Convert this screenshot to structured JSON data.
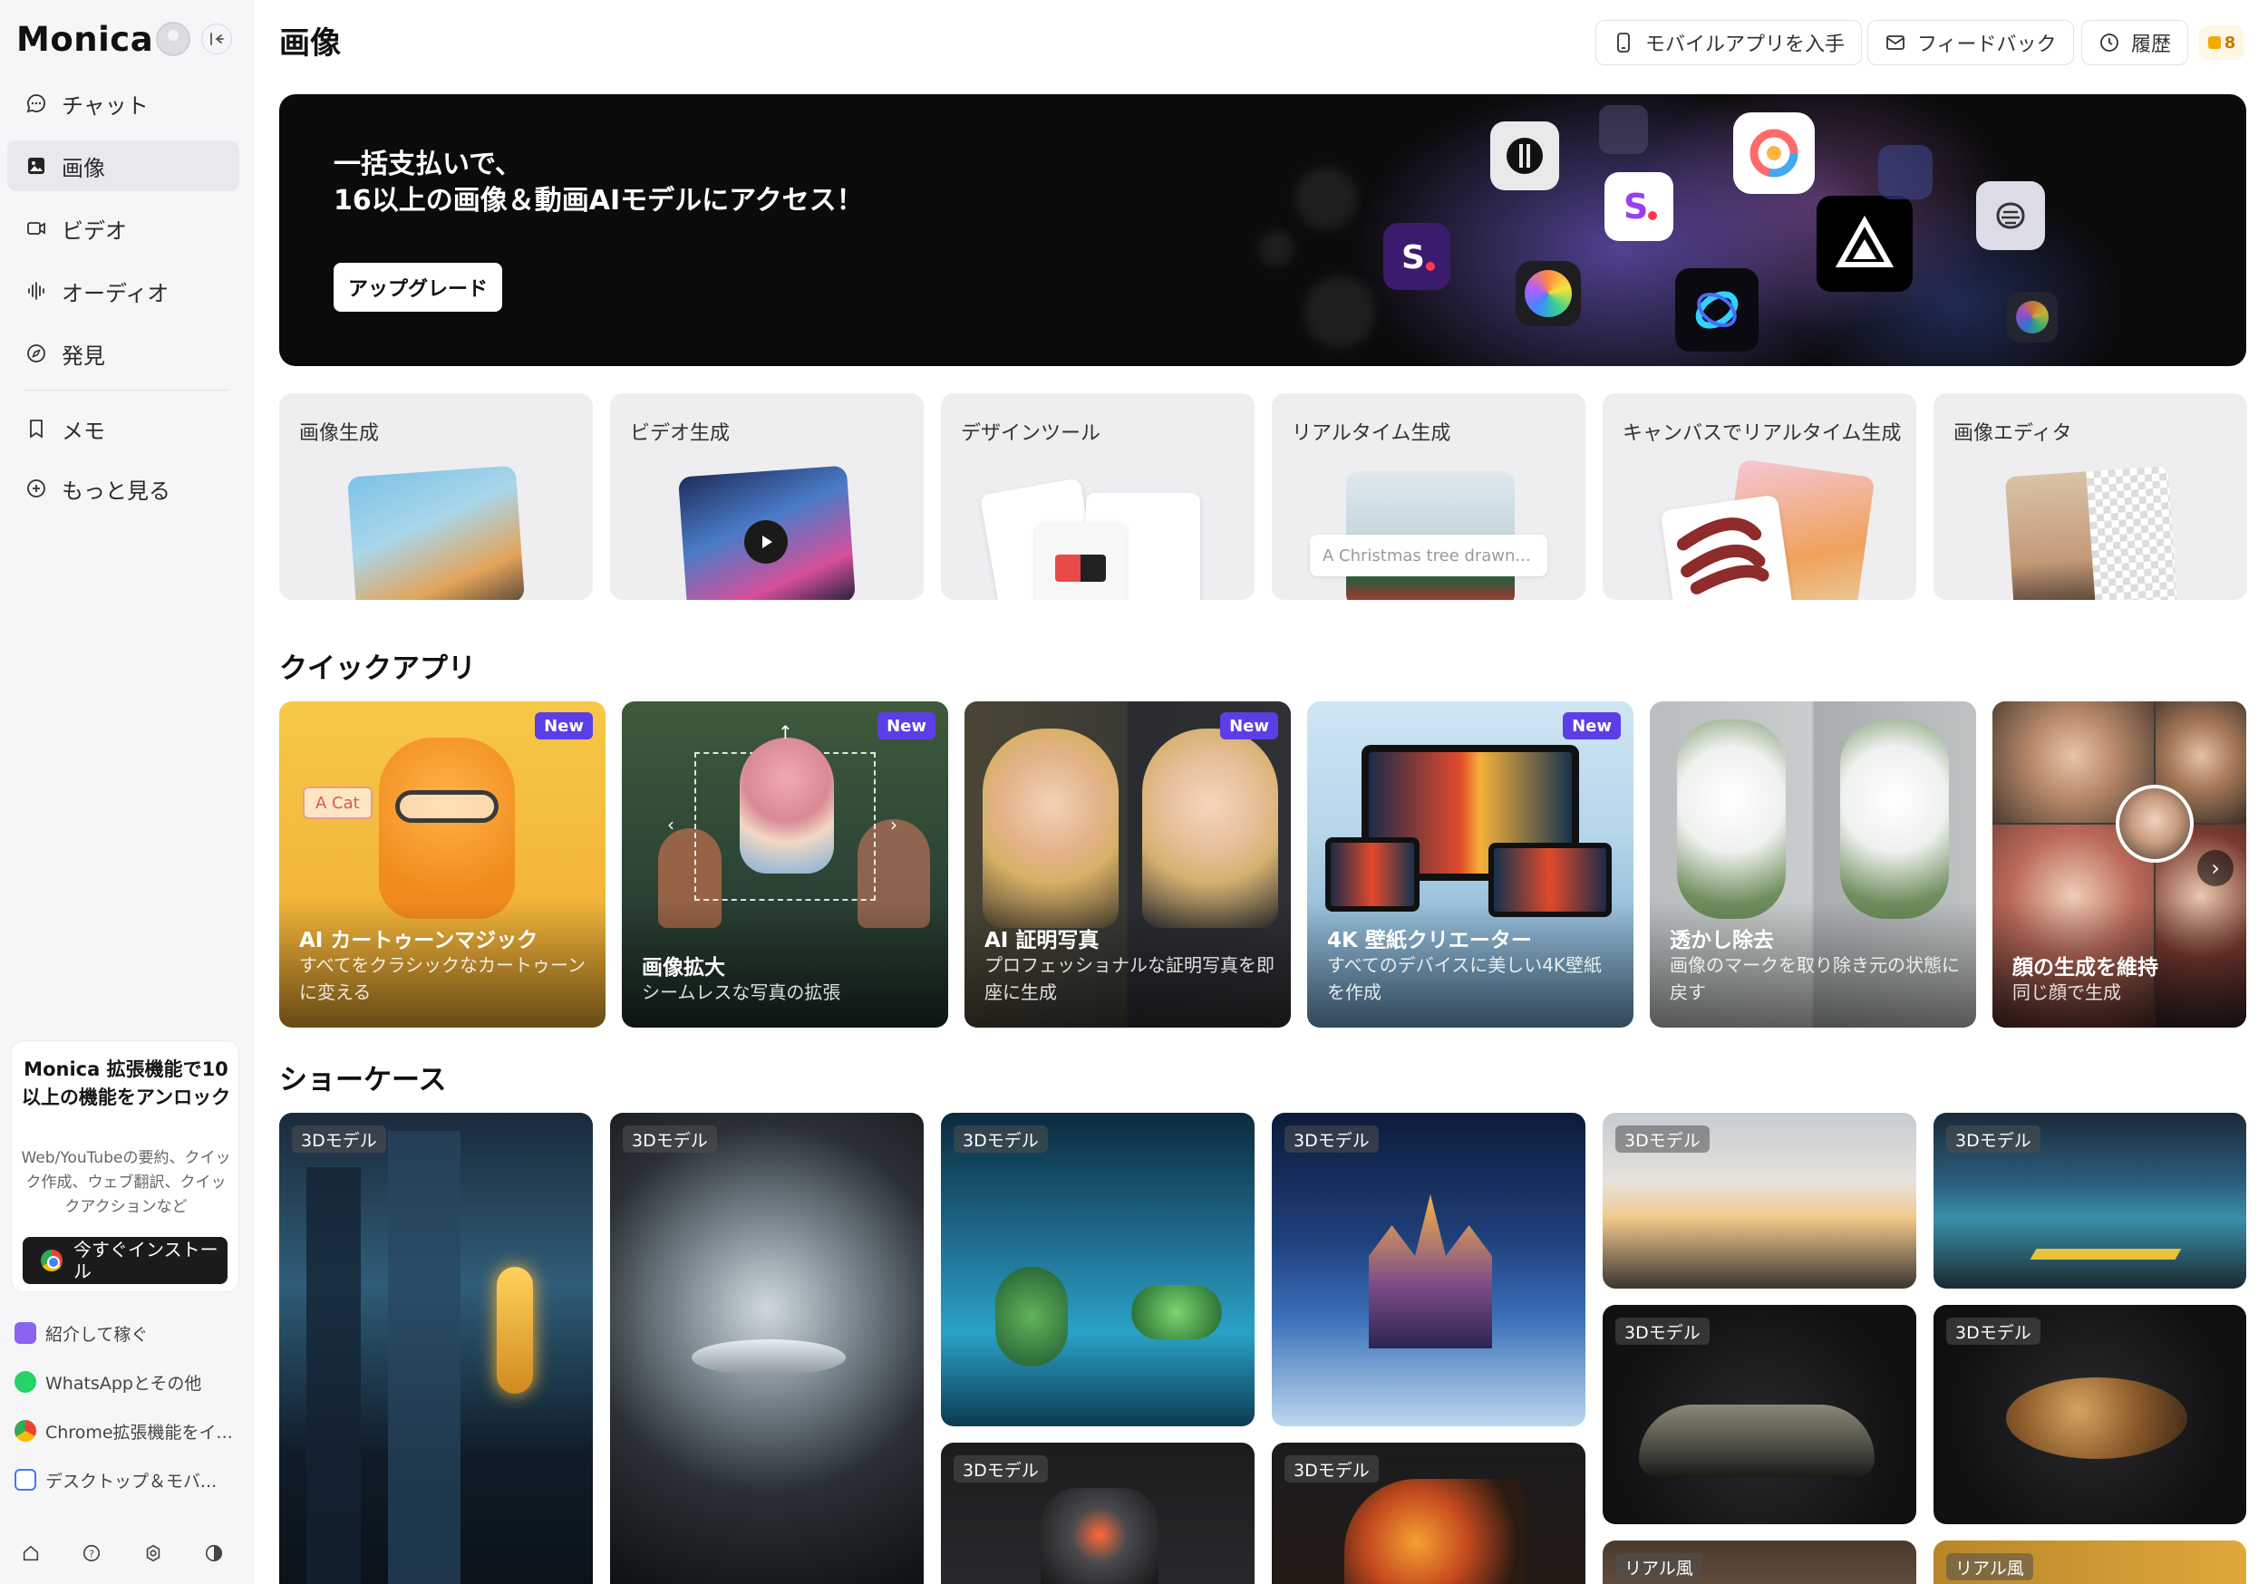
{
  "sidebar": {
    "brand": "Monica",
    "nav": [
      {
        "label": "チャット"
      },
      {
        "label": "画像"
      },
      {
        "label": "ビデオ"
      },
      {
        "label": "オーディオ"
      },
      {
        "label": "発見"
      },
      {
        "label": "メモ"
      },
      {
        "label": "もっと見る"
      }
    ],
    "promo": {
      "title": "Monica 拡張機能で10以上の機能をアンロック",
      "description": "Web/YouTubeの要約、クイック作成、ウェブ翻訳、クイックアクションなど",
      "button": "今すぐインストール"
    },
    "links": [
      {
        "label": "紹介して稼ぐ"
      },
      {
        "label": "WhatsAppとその他"
      },
      {
        "label": "Chrome拡張機能をイ..."
      },
      {
        "label": "デスクトップ＆モバ..."
      }
    ]
  },
  "header": {
    "title": "画像",
    "mobile_app": "モバイルアプリを入手",
    "feedback": "フィードバック",
    "history": "履歴",
    "credits": "8"
  },
  "hero": {
    "line1": "一括支払いで、",
    "line2": "16以上の画像＆動画AIモデルにアクセス！",
    "button": "アップグレード"
  },
  "tools": [
    {
      "label": "画像生成"
    },
    {
      "label": "ビデオ生成"
    },
    {
      "label": "デザインツール"
    },
    {
      "label": "リアルタイム生成",
      "prompt": "A Christmas tree drawn..."
    },
    {
      "label": "キャンバスでリアルタイム生成"
    },
    {
      "label": "画像エディタ"
    }
  ],
  "quick_apps": {
    "title": "クイックアプリ",
    "badge": "New",
    "items": [
      {
        "title": "AI カートゥーンマジック",
        "desc": "すべてをクラシックなカートゥーンに変える",
        "overlay": "A Cat",
        "new": true
      },
      {
        "title": "画像拡大",
        "desc": "シームレスな写真の拡張",
        "new": true
      },
      {
        "title": "AI 証明写真",
        "desc": "プロフェッショナルな証明写真を即座に生成",
        "new": true
      },
      {
        "title": "4K 壁紙クリエーター",
        "desc": "すべてのデバイスに美しい4K壁紙を作成",
        "new": true
      },
      {
        "title": "透かし除去",
        "desc": "画像のマークを取り除き元の状態に戻す",
        "new": false
      },
      {
        "title": "顔の生成を維持",
        "desc": "同じ顔で生成",
        "new": false
      }
    ]
  },
  "showcase": {
    "title": "ショーケース",
    "tag_3d": "3Dモデル",
    "tag_real": "リアル風"
  },
  "colors": {
    "accent_badge": "#5b3ee6",
    "sidebar_bg": "#f6f6f8",
    "hero_bg": "#0b0b0c"
  }
}
